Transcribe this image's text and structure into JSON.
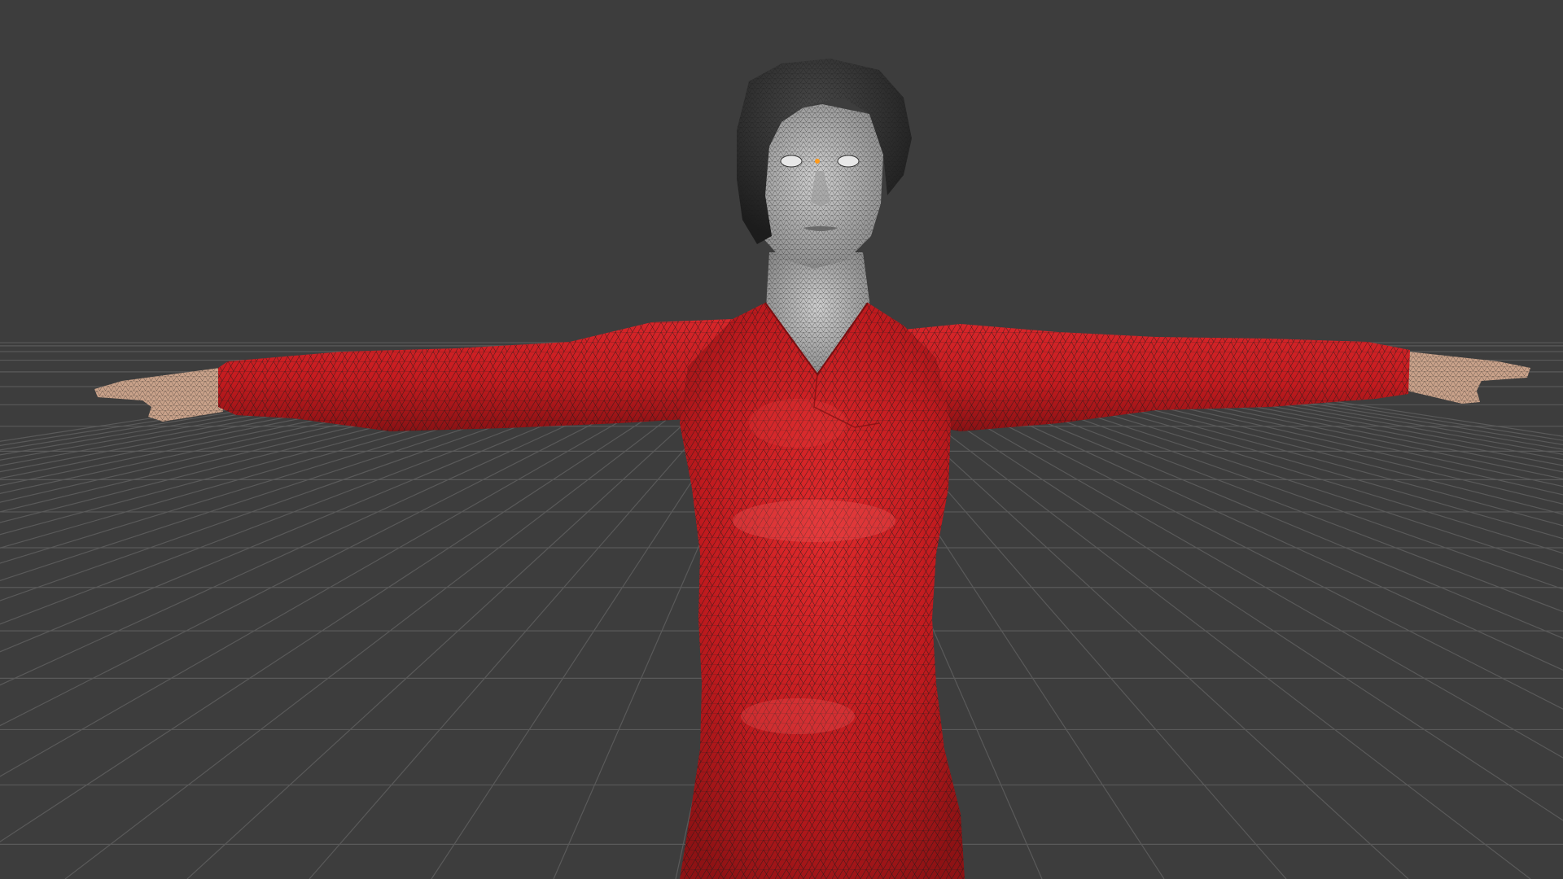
{
  "viewport": {
    "view": "3d-viewport",
    "shading": "solid-with-wireframe-overlay",
    "background_color": "#3d3d3d",
    "grid_color": "#5a5a5a"
  },
  "model": {
    "pose": "T-pose",
    "garment_color": "#c81a1e",
    "skin_color": "#b0b0b0",
    "hand_color": "#c9a28a",
    "hair_color": "#2a2a2a",
    "wire_color": "#1a1a1a",
    "origin_marker_color": "#ff9a1a"
  }
}
